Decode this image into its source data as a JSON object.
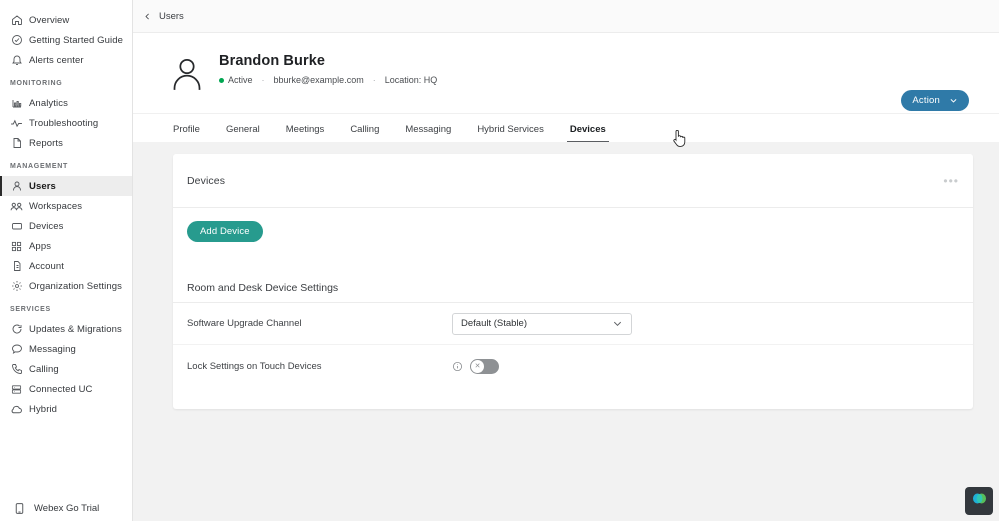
{
  "sidebar": {
    "top_items": [
      {
        "label": "Overview",
        "icon": "home-icon"
      },
      {
        "label": "Getting Started Guide",
        "icon": "check-circle-icon"
      },
      {
        "label": "Alerts center",
        "icon": "bell-icon"
      }
    ],
    "groups": [
      {
        "title": "MONITORING",
        "items": [
          {
            "label": "Analytics",
            "icon": "bar-chart-icon"
          },
          {
            "label": "Troubleshooting",
            "icon": "pulse-icon"
          },
          {
            "label": "Reports",
            "icon": "document-icon"
          }
        ]
      },
      {
        "title": "MANAGEMENT",
        "items": [
          {
            "label": "Users",
            "icon": "user-icon",
            "active": true
          },
          {
            "label": "Workspaces",
            "icon": "workspaces-icon"
          },
          {
            "label": "Devices",
            "icon": "device-icon"
          },
          {
            "label": "Apps",
            "icon": "apps-icon"
          },
          {
            "label": "Account",
            "icon": "account-icon"
          },
          {
            "label": "Organization Settings",
            "icon": "gear-icon"
          }
        ]
      },
      {
        "title": "SERVICES",
        "items": [
          {
            "label": "Updates & Migrations",
            "icon": "refresh-icon"
          },
          {
            "label": "Messaging",
            "icon": "message-icon"
          },
          {
            "label": "Calling",
            "icon": "phone-icon"
          },
          {
            "label": "Connected UC",
            "icon": "server-icon"
          },
          {
            "label": "Hybrid",
            "icon": "cloud-icon"
          }
        ]
      }
    ],
    "bottom_item": {
      "label": "Webex Go Trial",
      "icon": "mobile-icon"
    }
  },
  "breadcrumb": {
    "label": "Users",
    "back_icon": "chevron-left-icon"
  },
  "user": {
    "name": "Brandon Burke",
    "status": "Active",
    "status_color": "#00a651",
    "email": "bburke@example.com",
    "location": "Location: HQ",
    "separator": "·",
    "avatar_icon": "avatar-icon"
  },
  "action_button": {
    "label": "Action",
    "icon": "chevron-down-icon",
    "color": "#2f7aa8"
  },
  "tabs": [
    {
      "label": "Profile",
      "active": false
    },
    {
      "label": "General",
      "active": false
    },
    {
      "label": "Meetings",
      "active": false
    },
    {
      "label": "Calling",
      "active": false
    },
    {
      "label": "Messaging",
      "active": false
    },
    {
      "label": "Hybrid Services",
      "active": false
    },
    {
      "label": "Devices",
      "active": true
    }
  ],
  "devices_card": {
    "title": "Devices",
    "overflow_label": "•••",
    "add_device_label": "Add Device",
    "add_device_color": "#279b8e"
  },
  "room_desk_settings": {
    "heading": "Room and Desk Device Settings",
    "upgrade_channel": {
      "label": "Software Upgrade Channel",
      "value": "Default (Stable)",
      "chevron_icon": "chevron-down-icon"
    },
    "lock_settings": {
      "label": "Lock Settings on Touch Devices",
      "info_icon": "info-icon",
      "toggle_state": "off",
      "toggle_glyph": "✕"
    }
  },
  "webex_badge": {
    "icon": "webex-logo-icon"
  }
}
